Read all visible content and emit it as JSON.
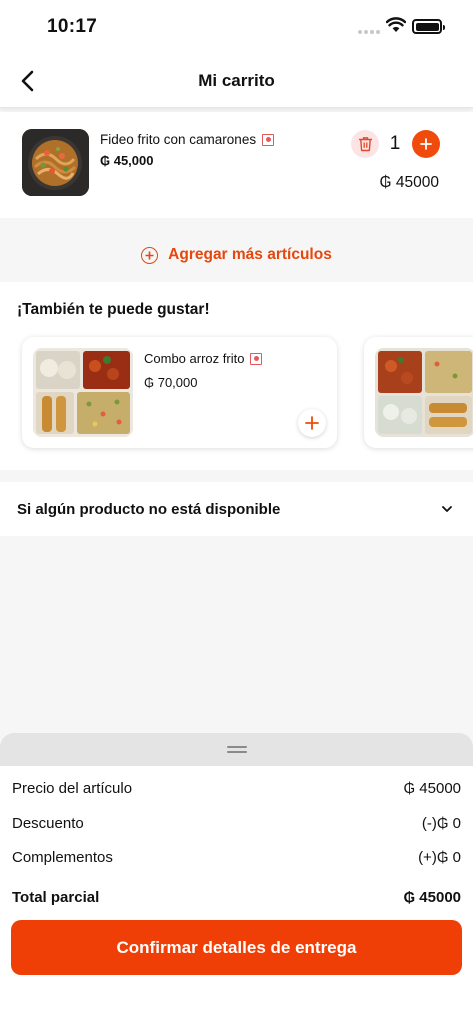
{
  "status_bar": {
    "time": "10:17"
  },
  "header": {
    "title": "Mi carrito"
  },
  "cart": {
    "items": [
      {
        "name": "Fideo frito con camarones",
        "price": "₲ 45,000",
        "quantity": "1",
        "total": "₲ 45000"
      }
    ],
    "add_more_label": "Agregar más artículos"
  },
  "suggestions": {
    "title": "¡También te puede gustar!",
    "items": [
      {
        "name": "Combo arroz frito",
        "price": "₲ 70,000"
      }
    ]
  },
  "unavailable": {
    "label": "Si algún producto no está disponible"
  },
  "summary": {
    "item_price_label": "Precio del artículo",
    "item_price_value": "₲ 45000",
    "discount_label": "Descuento",
    "discount_value": "(-)₲ 0",
    "addons_label": "Complementos",
    "addons_value": "(+)₲ 0",
    "subtotal_label": "Total parcial",
    "subtotal_value": "₲ 45000"
  },
  "confirm_button": {
    "label": "Confirmar detalles de entrega"
  },
  "colors": {
    "accent": "#f04a0c",
    "button": "#f03f06",
    "delete_bg": "#fde4e4",
    "veg_mark": "#e45a5a"
  },
  "icons": [
    "back-arrow-icon",
    "trash-icon",
    "plus-icon",
    "add-circle-icon",
    "chevron-down-icon",
    "wifi-icon",
    "battery-icon",
    "cellular-signal-icon",
    "drag-handle-icon"
  ]
}
